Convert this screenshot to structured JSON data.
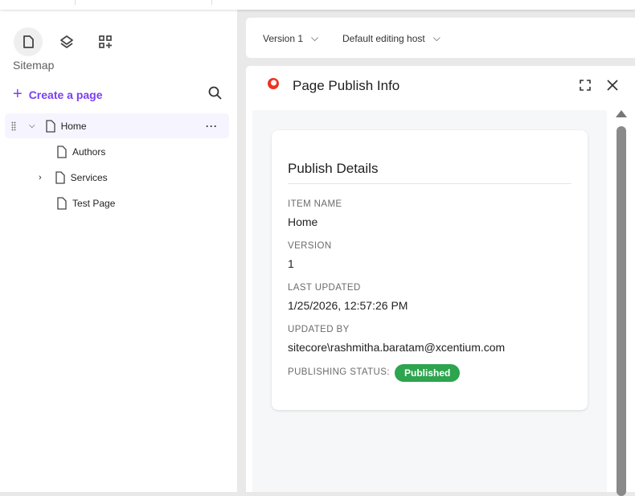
{
  "left": {
    "section_title": "Sitemap",
    "create_label": "Create a page",
    "tree": [
      {
        "label": "Home",
        "expanded": true
      },
      {
        "label": "Authors"
      },
      {
        "label": "Services",
        "expandable": true
      },
      {
        "label": "Test Page"
      }
    ]
  },
  "toolbar": {
    "version": "Version 1",
    "host": "Default editing host"
  },
  "panel": {
    "title": "Page Publish Info",
    "card_title": "Publish Details",
    "fields": [
      {
        "label": "ITEM NAME",
        "value": "Home"
      },
      {
        "label": "VERSION",
        "value": "1"
      },
      {
        "label": "LAST UPDATED",
        "value": "1/25/2026, 12:57:26 PM"
      },
      {
        "label": "UPDATED BY",
        "value": "sitecore\\rashmitha.baratam@xcentium.com"
      }
    ],
    "status_label": "PUBLISHING STATUS:",
    "status": "Published",
    "status_color": "#2da44e"
  },
  "accent": "#7a3ff2"
}
